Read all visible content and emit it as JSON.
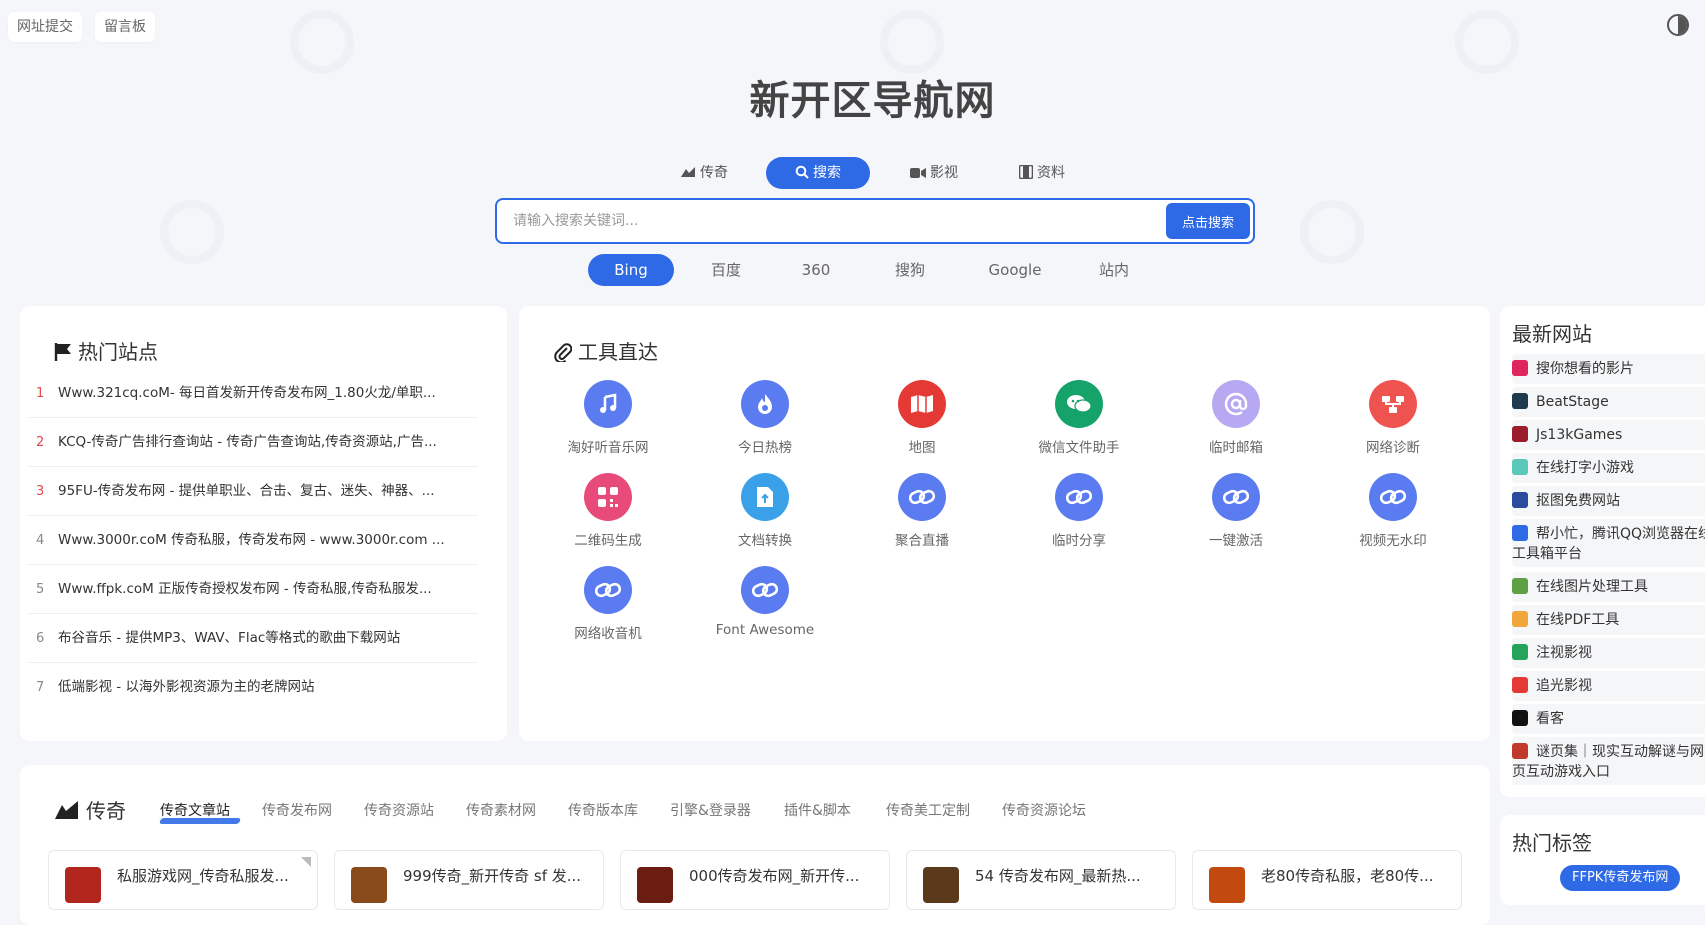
{
  "top_links": [
    "网址提交",
    "留言板"
  ],
  "site_title": "新开区导航网",
  "search": {
    "tabs": [
      "传奇",
      "搜索",
      "影视",
      "资料"
    ],
    "active_tab": "搜索",
    "placeholder": "请输入搜索关键词...",
    "submit_label": "点击搜索",
    "engines": [
      "Bing",
      "百度",
      "360",
      "搜狗",
      "Google",
      "站内"
    ],
    "active_engine": "Bing"
  },
  "hot_sites": {
    "title": "热门站点",
    "items": [
      {
        "num": "1",
        "text": "Www.321cq.coM- 每日首发新开传奇发布网_1.80火龙/单职..."
      },
      {
        "num": "2",
        "text": "KCQ-传奇广告排行查询站 - 传奇广告查询站,传奇资源站,广告..."
      },
      {
        "num": "3",
        "text": "95FU-传奇发布网 - 提供单职业、合击、复古、迷失、神器、..."
      },
      {
        "num": "4",
        "text": "Www.3000r.coM 传奇私服，传奇发布网 - www.3000r.com ..."
      },
      {
        "num": "5",
        "text": "Www.ffpk.coM 正版传奇授权发布网 - 传奇私服,传奇私服发..."
      },
      {
        "num": "6",
        "text": "布谷音乐 - 提供MP3、WAV、Flac等格式的歌曲下载网站"
      },
      {
        "num": "7",
        "text": "低端影视 - 以海外影视资源为主的老牌网站"
      }
    ]
  },
  "tools": {
    "title": "工具直达",
    "items": [
      {
        "label": "淘好听音乐网",
        "icon": "music-icon",
        "color": "#5b7cf0"
      },
      {
        "label": "今日热榜",
        "icon": "fire-icon",
        "color": "#5b7cf0"
      },
      {
        "label": "地图",
        "icon": "map-icon",
        "color": "#e53935"
      },
      {
        "label": "微信文件助手",
        "icon": "wechat-icon",
        "color": "#16a36a"
      },
      {
        "label": "临时邮箱",
        "icon": "at-icon",
        "color": "#b7a8f2"
      },
      {
        "label": "网络诊断",
        "icon": "network-icon",
        "color": "#ef5350"
      },
      {
        "label": "二维码生成",
        "icon": "qrcode-icon",
        "color": "#e84a7a"
      },
      {
        "label": "文档转换",
        "icon": "document-icon",
        "color": "#3aa1e8"
      },
      {
        "label": "聚合直播",
        "icon": "link-icon",
        "color": "#5b7cf0"
      },
      {
        "label": "临时分享",
        "icon": "link-icon",
        "color": "#5b7cf0"
      },
      {
        "label": "一键激活",
        "icon": "link-icon",
        "color": "#5b7cf0"
      },
      {
        "label": "视频无水印",
        "icon": "link-icon",
        "color": "#5b7cf0"
      },
      {
        "label": "网络收音机",
        "icon": "link-icon",
        "color": "#5b7cf0"
      },
      {
        "label": "Font Awesome",
        "icon": "link-icon",
        "color": "#5b7cf0"
      }
    ]
  },
  "new_sites": {
    "title": "最新网站",
    "items": [
      {
        "label": "搜你想看的影片",
        "color": "#e0245e"
      },
      {
        "label": "BeatStage",
        "color": "#1f3a4d"
      },
      {
        "label": "Js13kGames",
        "color": "#9b1c2c"
      },
      {
        "label": "在线打字小游戏",
        "color": "#5ac8b8"
      },
      {
        "label": "抠图免费网站",
        "color": "#2b4c9e"
      },
      {
        "label": "帮小忙，腾讯QQ浏览器在线工具箱平台",
        "color": "#2f6ae6"
      },
      {
        "label": "在线图片处理工具",
        "color": "#5ca043"
      },
      {
        "label": "在线PDF工具",
        "color": "#f0a63a"
      },
      {
        "label": "注视影视",
        "color": "#25a35a"
      },
      {
        "label": "追光影视",
        "color": "#e53935"
      },
      {
        "label": "看客",
        "color": "#111111"
      },
      {
        "label": "谜页集｜现实互动解谜与网页互动游戏入口",
        "color": "#c0392b"
      }
    ]
  },
  "hot_tags": {
    "title": "热门标签",
    "tags": [
      "FFPK传奇发布网"
    ]
  },
  "legend_section": {
    "title": "传奇",
    "tabs": [
      "传奇文章站",
      "传奇发布网",
      "传奇资源站",
      "传奇素材网",
      "传奇版本库",
      "引擎&登录器",
      "插件&脚本",
      "传奇美工定制",
      "传奇资源论坛"
    ],
    "active_tab": "传奇文章站",
    "cards": [
      {
        "name": "私服游戏网_传奇私服发..."
      },
      {
        "name": "999传奇_新开传奇 sf 发..."
      },
      {
        "name": "000传奇发布网_新开传..."
      },
      {
        "name": "54 传奇发布网_最新热..."
      },
      {
        "name": "老80传奇私服，老80传..."
      }
    ]
  },
  "colors": {
    "accent": "#2f6ae6",
    "hot_red": "#e5484d"
  }
}
